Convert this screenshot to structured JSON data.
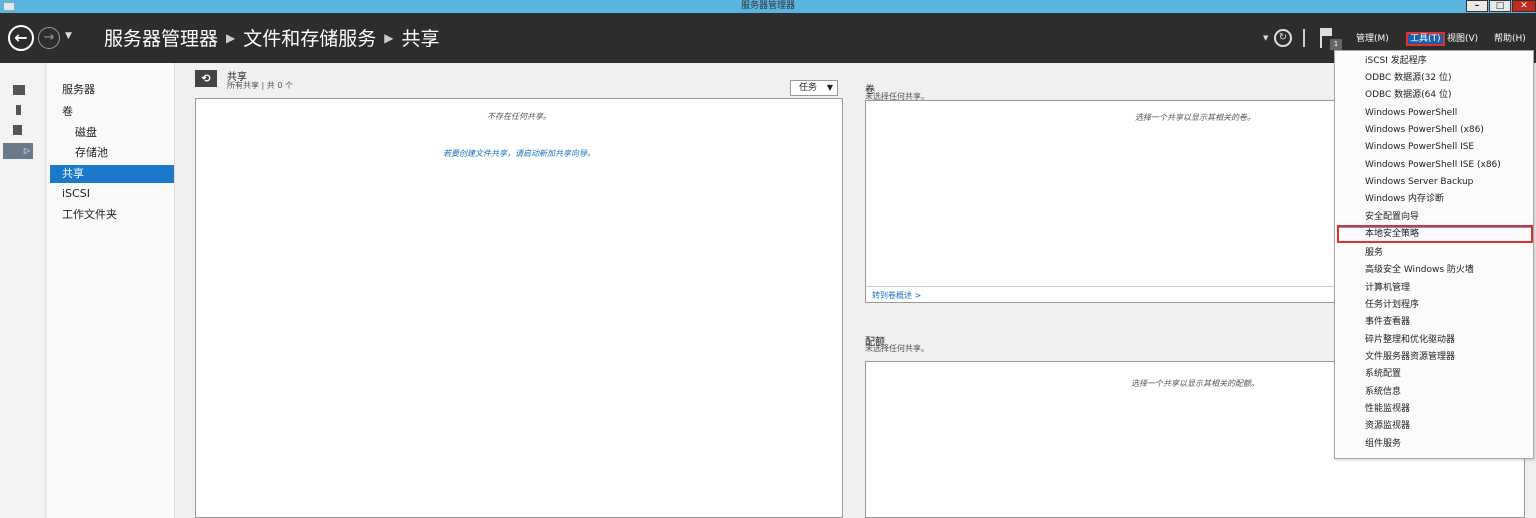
{
  "window": {
    "title": "服务器管理器"
  },
  "header": {
    "breadcrumb": [
      "服务器管理器",
      "文件和存储服务",
      "共享"
    ],
    "flag_count": "1",
    "menu": {
      "manage": "管理(M)",
      "tools": "工具(T)",
      "view": "视图(V)",
      "help": "帮助(H)"
    }
  },
  "nav": {
    "items": [
      "服务器",
      "卷",
      "磁盘",
      "存储池",
      "共享",
      "iSCSI",
      "工作文件夹"
    ],
    "active": "共享"
  },
  "shares": {
    "title": "共享",
    "subtitle": "所有共享 | 共 0 个",
    "task_label": "任务",
    "empty_message": "不存在任何共享。",
    "wizard_link": "若要创建文件共享，请启动新加共享向导。"
  },
  "volume": {
    "title": "卷",
    "subtitle": "未选择任何共享。",
    "message": "选择一个共享以显示其相关的卷。",
    "link": "转到卷概述 >"
  },
  "quota": {
    "title": "配额",
    "subtitle": "未选择任何共享。",
    "message": "选择一个共享以显示其相关的配额。"
  },
  "tools_menu": {
    "items": [
      "iSCSI 发起程序",
      "ODBC 数据源(32 位)",
      "ODBC 数据源(64 位)",
      "Windows PowerShell",
      "Windows PowerShell (x86)",
      "Windows PowerShell ISE",
      "Windows PowerShell ISE (x86)",
      "Windows Server Backup",
      "Windows 内存诊断",
      "安全配置向导",
      "本地安全策略",
      "服务",
      "高级安全 Windows 防火墙",
      "计算机管理",
      "任务计划程序",
      "事件查看器",
      "碎片整理和优化驱动器",
      "文件服务器资源管理器",
      "系统配置",
      "系统信息",
      "性能监视器",
      "资源监视器",
      "组件服务"
    ],
    "highlighted": "本地安全策略"
  },
  "colors": {
    "accent": "#1a79c8",
    "header_bg": "#2d2d2d",
    "titlebar": "#5ab4e0",
    "highlight_border": "#e03030"
  }
}
